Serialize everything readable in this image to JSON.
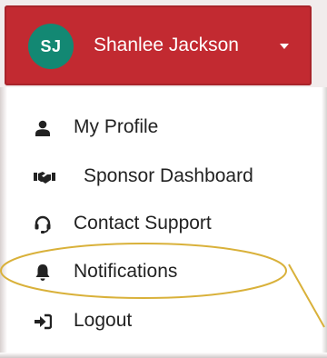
{
  "user": {
    "initials": "SJ",
    "name": "Shanlee Jackson",
    "avatar_color": "#138873",
    "toggle_color": "#c22a31",
    "caret_icon": "caret-down-icon"
  },
  "menu": {
    "items": [
      {
        "label": "My Profile",
        "icon": "user-icon"
      },
      {
        "label": "Sponsor Dashboard",
        "icon": "handshake-icon"
      },
      {
        "label": "Contact Support",
        "icon": "headset-icon"
      },
      {
        "label": "Notifications",
        "icon": "bell-icon"
      },
      {
        "label": "Logout",
        "icon": "sign-out-icon"
      }
    ]
  },
  "annotation": {
    "highlight_color": "#d9b13a",
    "highlighted_item": "Notifications"
  }
}
